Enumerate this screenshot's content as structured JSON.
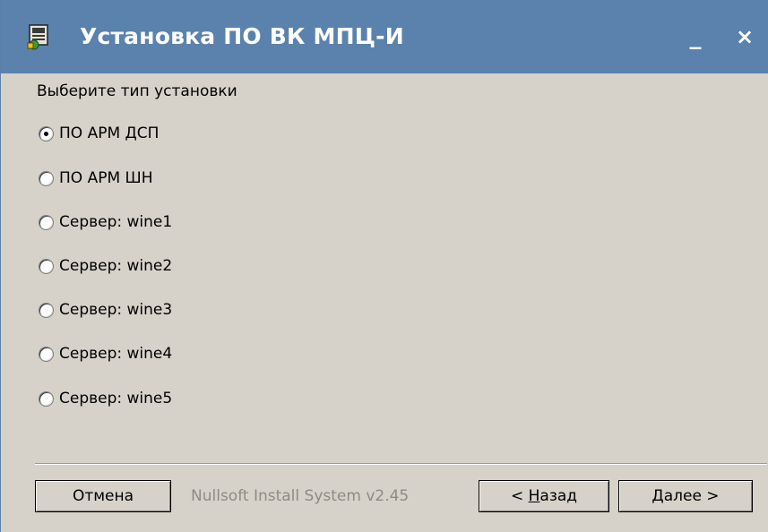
{
  "window": {
    "title": "Установка ПО ВК МПЦ-И",
    "minimize_glyph": "_",
    "close_glyph": "×",
    "icon": "installer-box-icon"
  },
  "prompt": "Выберите тип установки",
  "options": [
    {
      "label": "ПО АРМ ДСП",
      "checked": true
    },
    {
      "label": "ПО АРМ ШН",
      "checked": false
    },
    {
      "label": "Сервер: wine1",
      "checked": false
    },
    {
      "label": "Сервер: wine2",
      "checked": false
    },
    {
      "label": "Сервер: wine3",
      "checked": false
    },
    {
      "label": "Сервер: wine4",
      "checked": false
    },
    {
      "label": "Сервер: wine5",
      "checked": false
    }
  ],
  "footer": {
    "cancel_label": "Отмена",
    "branding": "Nullsoft Install System v2.45",
    "back_prefix": "< ",
    "back_mnemonic": "Н",
    "back_rest": "азад",
    "next_mnemonic": "Д",
    "next_rest": "алее >"
  },
  "colors": {
    "titlebar": "#5a82ad",
    "background": "#d6d2ca",
    "disabled_text": "#8e8b86"
  }
}
